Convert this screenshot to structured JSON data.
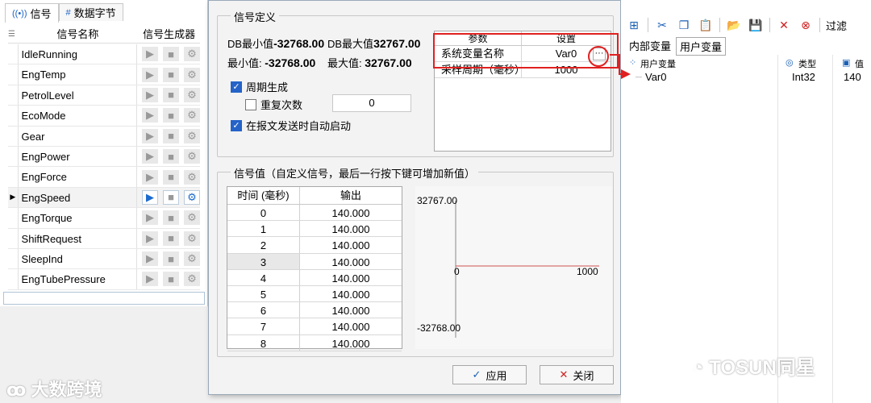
{
  "left": {
    "tabs": [
      {
        "label": "信号"
      },
      {
        "label": "数据字节"
      }
    ],
    "col_name": "信号名称",
    "col_gen": "信号生成器",
    "signals": [
      "IdleRunning",
      "EngTemp",
      "PetrolLevel",
      "EcoMode",
      "Gear",
      "EngPower",
      "EngForce",
      "EngSpeed",
      "EngTorque",
      "ShiftRequest",
      "SleepInd",
      "EngTubePressure"
    ],
    "selected_index": 7
  },
  "dialog": {
    "def_title": "信号定义",
    "db_min_label": "DB最小值",
    "db_min_value": "-32768.00",
    "db_max_label": "DB最大值",
    "db_max_value": "32767.00",
    "min_label": "最小值:",
    "min_value": "-32768.00",
    "max_label": "最大值:",
    "max_value": "32767.00",
    "periodic_label": "周期生成",
    "repeat_label": "重复次数",
    "repeat_value": "0",
    "autostart_label": "在报文发送时自动启动",
    "param_head_1": "参数",
    "param_head_2": "设置",
    "param_rows": [
      {
        "name": "系统变量名称",
        "value": "Var0"
      },
      {
        "name": "采样周期（毫秒）",
        "value": "1000"
      }
    ],
    "values_title": "信号值（自定义信号，最后一行按下键可增加新值）",
    "col_time": "时间 (毫秒)",
    "col_output": "输出",
    "value_rows": [
      {
        "t": "0",
        "v": "140.000"
      },
      {
        "t": "1",
        "v": "140.000"
      },
      {
        "t": "2",
        "v": "140.000"
      },
      {
        "t": "3",
        "v": "140.000"
      },
      {
        "t": "4",
        "v": "140.000"
      },
      {
        "t": "5",
        "v": "140.000"
      },
      {
        "t": "6",
        "v": "140.000"
      },
      {
        "t": "7",
        "v": "140.000"
      },
      {
        "t": "8",
        "v": "140.000"
      }
    ],
    "plot_ymax": "32767.00",
    "plot_ymin": "-32768.00",
    "plot_x0": "0",
    "plot_x1": "1000",
    "apply_label": "应用",
    "close_label": "关闭"
  },
  "right": {
    "filter_label": "过滤",
    "tab_internal": "内部变量",
    "tab_user": "用户变量",
    "col_name": "用户变量",
    "col_type": "类型",
    "col_value": "值",
    "var_name": "Var0",
    "var_type": "Int32",
    "var_value": "140"
  },
  "watermarks": {
    "left": "大数跨境",
    "right": "TOSUN同星"
  },
  "colors": {
    "accent": "#2563c8",
    "highlight": "#e02020"
  }
}
